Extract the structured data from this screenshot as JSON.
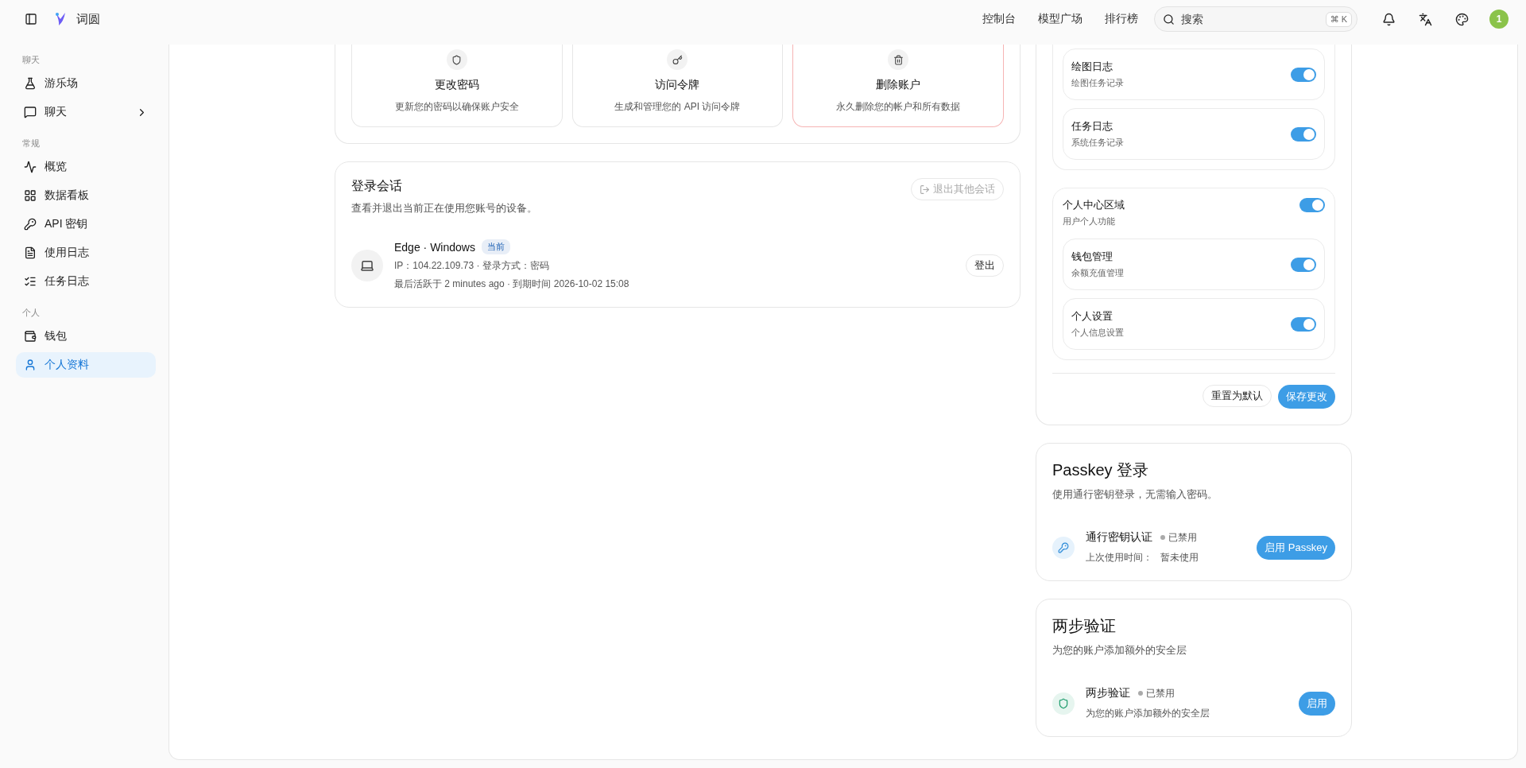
{
  "topbar": {
    "brand": "词圆",
    "nav": [
      "控制台",
      "模型广场",
      "排行榜"
    ],
    "search": {
      "placeholder": "搜索",
      "shortcut_symbol": "⌘",
      "shortcut_key": "K"
    },
    "avatar": "1"
  },
  "sidebar": {
    "sections": [
      {
        "title": "聊天",
        "items": [
          {
            "label": "游乐场",
            "selected": false,
            "expandable": false
          },
          {
            "label": "聊天",
            "selected": false,
            "expandable": true
          }
        ]
      },
      {
        "title": "常规",
        "items": [
          {
            "label": "概览",
            "selected": false,
            "expandable": false
          },
          {
            "label": "数据看板",
            "selected": false,
            "expandable": false
          },
          {
            "label": "API 密钥",
            "selected": false,
            "expandable": false
          },
          {
            "label": "使用日志",
            "selected": false,
            "expandable": false
          },
          {
            "label": "任务日志",
            "selected": false,
            "expandable": false
          }
        ]
      },
      {
        "title": "个人",
        "items": [
          {
            "label": "钱包",
            "selected": false,
            "expandable": false
          },
          {
            "label": "个人资料",
            "selected": true,
            "expandable": false
          }
        ]
      }
    ]
  },
  "quick_actions": [
    {
      "title": "更改密码",
      "desc": "更新您的密码以确保账户安全",
      "kind": "normal"
    },
    {
      "title": "访问令牌",
      "desc": "生成和管理您的 API 访问令牌",
      "kind": "normal"
    },
    {
      "title": "删除账户",
      "desc": "永久删除您的帐户和所有数据",
      "kind": "danger"
    }
  ],
  "sessions": {
    "title": "登录会话",
    "desc": "查看并退出当前正在使用您账号的设备。",
    "logout_others": "退出其他会话",
    "devices": [
      {
        "name": "Edge · Windows",
        "badge": "当前",
        "ip": "IP：104.22.109.73 · 登录方式：密码",
        "activity": "最后活跃于 2 minutes ago · 到期时间 2026-10-02 15:08",
        "button": "登出"
      }
    ]
  },
  "sidebar_settings": {
    "groups": [
      {
        "children": [
          {
            "title": "绘图日志",
            "desc": "绘图任务记录",
            "on": true
          },
          {
            "title": "任务日志",
            "desc": "系统任务记录",
            "on": true
          }
        ]
      },
      {
        "title": "个人中心区域",
        "desc": "用户个人功能",
        "on": true,
        "children": [
          {
            "title": "钱包管理",
            "desc": "余额充值管理",
            "on": true
          },
          {
            "title": "个人设置",
            "desc": "个人信息设置",
            "on": true
          }
        ]
      }
    ],
    "reset": "重置为默认",
    "save": "保存更改"
  },
  "passkey": {
    "title": "Passkey 登录",
    "desc": "使用通行密钥登录，无需输入密码。",
    "name": "通行密钥认证",
    "status": "已禁用",
    "last_used_label": "上次使用时间：",
    "last_used_value": "暂未使用",
    "button": "启用 Passkey"
  },
  "two_factor": {
    "title": "两步验证",
    "desc": "为您的账户添加额外的安全层",
    "name": "两步验证",
    "status": "已禁用",
    "detail": "为您的账户添加额外的安全层",
    "button": "启用"
  }
}
